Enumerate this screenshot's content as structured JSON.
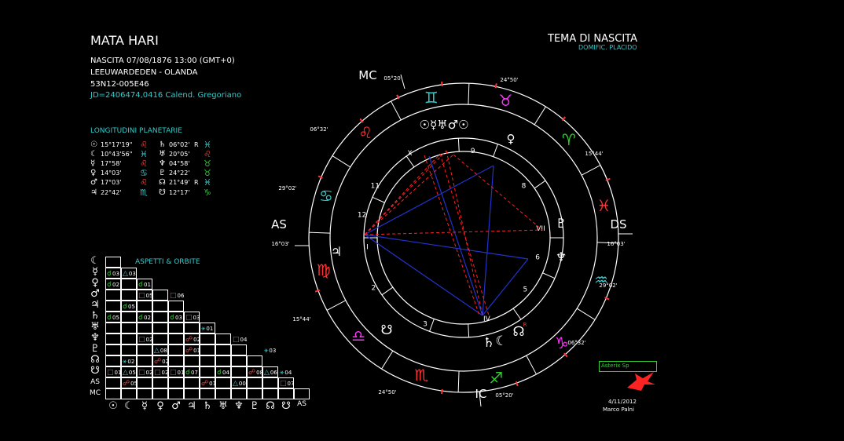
{
  "header": {
    "name": "MATA HARI",
    "birth": "NASCITA 07/08/1876 13:00 (GMT+0)",
    "place": "LEEUWARDEDEN - OLANDA",
    "coords": "53N12-005E46",
    "jd": "JD=2406474,0416  Calend. Gregoriano"
  },
  "chart_title": {
    "title": "TEMA DI NASCITA",
    "subtitle": "DOMIFIC. PLACIDO"
  },
  "planet_section_title": "LONGITUDINI PLANETARIE",
  "planets": [
    {
      "glyph": "☉",
      "deg": "15°17'19\"",
      "sign": "♌",
      "sign_color": "#ff4444",
      "glyph2": "♄",
      "deg2": "06°02'",
      "retro": "R",
      "sign2": "♓",
      "sign2_color": "#33cccc"
    },
    {
      "glyph": "☾",
      "deg": "10°43'56\"",
      "sign": "♓",
      "sign_color": "#33cccc",
      "glyph2": "♅",
      "deg2": "20°05'",
      "retro": "",
      "sign2": "♌",
      "sign2_color": "#ff4444"
    },
    {
      "glyph": "☿",
      "deg": "17°58'",
      "sign": "♌",
      "sign_color": "#ff4444",
      "glyph2": "♆",
      "deg2": "04°58'",
      "retro": "",
      "sign2": "♉",
      "sign2_color": "#33cc33"
    },
    {
      "glyph": "♀",
      "deg": "14°03'",
      "sign": "♋",
      "sign_color": "#33cccc",
      "glyph2": "♇",
      "deg2": "24°22'",
      "retro": "",
      "sign2": "♉",
      "sign2_color": "#33cc33"
    },
    {
      "glyph": "♂",
      "deg": "17°03'",
      "sign": "♌",
      "sign_color": "#ff4444",
      "glyph2": "☊",
      "deg2": "21°49'",
      "retro": "R",
      "sign2": "♓",
      "sign2_color": "#33cccc"
    },
    {
      "glyph": "♃",
      "deg": "22°42'",
      "sign": "♏",
      "sign_color": "#33cccc",
      "glyph2": "☋",
      "deg2": "12°17'",
      "retro": "",
      "sign2": "♑",
      "sign2_color": "#33cc33"
    }
  ],
  "aspects_title": "ASPETTI  &  ORBITE",
  "aspect_row_labels": [
    "☾",
    "☿",
    "♀",
    "♂",
    "♃",
    "♄",
    "♅",
    "♆",
    "♇",
    "☊",
    "☋",
    "AS",
    "MC"
  ],
  "aspect_col_labels": [
    "☉",
    "☾",
    "☿",
    "♀",
    "♂",
    "♃",
    "♄",
    "♅",
    "♆",
    "♇",
    "☊",
    "☋",
    "AS"
  ],
  "aspects": [
    {
      "r": 1,
      "c": 0,
      "sym": "☌",
      "val": "03",
      "color": "#33cc33"
    },
    {
      "r": 1,
      "c": 1,
      "sym": "△",
      "val": "03",
      "color": "#33cccc"
    },
    {
      "r": 2,
      "c": 0,
      "sym": "☌",
      "val": "02",
      "color": "#33cc33"
    },
    {
      "r": 2,
      "c": 2,
      "sym": "☌",
      "val": "01",
      "color": "#33cc33"
    },
    {
      "r": 3,
      "c": 2,
      "sym": "□",
      "val": "05",
      "color": "#ff4444"
    },
    {
      "r": 3,
      "c": 4,
      "sym": "□",
      "val": "06",
      "color": "#ff4444"
    },
    {
      "r": 4,
      "c": 1,
      "sym": "☌",
      "val": "05",
      "color": "#33cc33"
    },
    {
      "r": 5,
      "c": 0,
      "sym": "☌",
      "val": "05",
      "color": "#33cc33"
    },
    {
      "r": 5,
      "c": 2,
      "sym": "☌",
      "val": "02",
      "color": "#33cc33"
    },
    {
      "r": 5,
      "c": 4,
      "sym": "☌",
      "val": "03",
      "color": "#33cc33"
    },
    {
      "r": 5,
      "c": 5,
      "sym": "□",
      "val": "03",
      "color": "#ff4444"
    },
    {
      "r": 6,
      "c": 6,
      "sym": "⚹",
      "val": "01",
      "color": "#33cccc"
    },
    {
      "r": 7,
      "c": 2,
      "sym": "□",
      "val": "02",
      "color": "#ff4444"
    },
    {
      "r": 7,
      "c": 5,
      "sym": "☍",
      "val": "02",
      "color": "#ff4444"
    },
    {
      "r": 7,
      "c": 8,
      "sym": "□",
      "val": "04",
      "color": "#ff4444"
    },
    {
      "r": 8,
      "c": 3,
      "sym": "△",
      "val": "08",
      "color": "#33cccc"
    },
    {
      "r": 8,
      "c": 5,
      "sym": "☍",
      "val": "01",
      "color": "#ff4444"
    },
    {
      "r": 8,
      "c": 10,
      "sym": "⚹",
      "val": "03",
      "color": "#33cccc"
    },
    {
      "r": 9,
      "c": 1,
      "sym": "⚹",
      "val": "02",
      "color": "#33cccc"
    },
    {
      "r": 9,
      "c": 3,
      "sym": "☍",
      "val": "02",
      "color": "#ff4444"
    },
    {
      "r": 10,
      "c": 0,
      "sym": "□",
      "val": "01",
      "color": "#ff4444"
    },
    {
      "r": 10,
      "c": 1,
      "sym": "△",
      "val": "05",
      "color": "#33cccc"
    },
    {
      "r": 10,
      "c": 2,
      "sym": "□",
      "val": "02",
      "color": "#ff4444"
    },
    {
      "r": 10,
      "c": 3,
      "sym": "□",
      "val": "02",
      "color": "#ff4444"
    },
    {
      "r": 10,
      "c": 4,
      "sym": "□",
      "val": "01",
      "color": "#ff4444"
    },
    {
      "r": 10,
      "c": 5,
      "sym": "☌",
      "val": "07",
      "color": "#33cc33"
    },
    {
      "r": 10,
      "c": 7,
      "sym": "☌",
      "val": "04",
      "color": "#33cc33"
    },
    {
      "r": 10,
      "c": 9,
      "sym": "☍",
      "val": "08",
      "color": "#ff4444"
    },
    {
      "r": 10,
      "c": 10,
      "sym": "△",
      "val": "06",
      "color": "#33cccc"
    },
    {
      "r": 10,
      "c": 11,
      "sym": "⚹",
      "val": "04",
      "color": "#33cccc"
    },
    {
      "r": 11,
      "c": 1,
      "sym": "☍",
      "val": "05",
      "color": "#ff4444"
    },
    {
      "r": 11,
      "c": 6,
      "sym": "☍",
      "val": "01",
      "color": "#ff4444"
    },
    {
      "r": 11,
      "c": 8,
      "sym": "△",
      "val": "00",
      "color": "#33cccc"
    },
    {
      "r": 11,
      "c": 11,
      "sym": "□",
      "val": "07",
      "color": "#ff4444"
    }
  ],
  "wheel": {
    "mc": "MC",
    "as": "AS",
    "ds": "DS",
    "ic": "IC",
    "mc_deg": "05°20'",
    "ic_deg": "05°20'",
    "as_deg": "16°03'",
    "ds_deg": "16°03'",
    "cusp_labels": [
      "24°50'",
      "15°44'",
      "29°02'",
      "06°32'",
      "24°50'",
      "15°44'",
      "29°02'",
      "06°32'"
    ],
    "house_numbers": [
      "I",
      "2",
      "3",
      "IV",
      "5",
      "6",
      "VII",
      "8",
      "9",
      "X",
      "11",
      "12"
    ],
    "signs": [
      {
        "glyph": "♍",
        "color": "#ff3333"
      },
      {
        "glyph": "♎",
        "color": "#ff33ff"
      },
      {
        "glyph": "♏",
        "color": "#ff3333"
      },
      {
        "glyph": "♐",
        "color": "#33cc33"
      },
      {
        "glyph": "♑",
        "color": "#ff33ff"
      },
      {
        "glyph": "♒",
        "color": "#33cccc"
      },
      {
        "glyph": "♓",
        "color": "#ff3333"
      },
      {
        "glyph": "♈",
        "color": "#33cc33"
      },
      {
        "glyph": "♉",
        "color": "#ff33ff"
      },
      {
        "glyph": "♊",
        "color": "#33cccc"
      },
      {
        "glyph": "♌",
        "color": "#ff3333"
      },
      {
        "glyph": "♋",
        "color": "#33cccc"
      }
    ],
    "planet_cluster_top": "☉☿♅♂☉",
    "venus": "♀",
    "neptune": "♆",
    "pluto": "♇",
    "jupiter": "♃",
    "saturn": "♄",
    "moon": "☾",
    "node": "☊",
    "node_r": "R",
    "south_node": "☋"
  },
  "footer": {
    "logo_text": "Asterix Sp",
    "date": "4/11/2012",
    "author": "Marco Palni"
  }
}
